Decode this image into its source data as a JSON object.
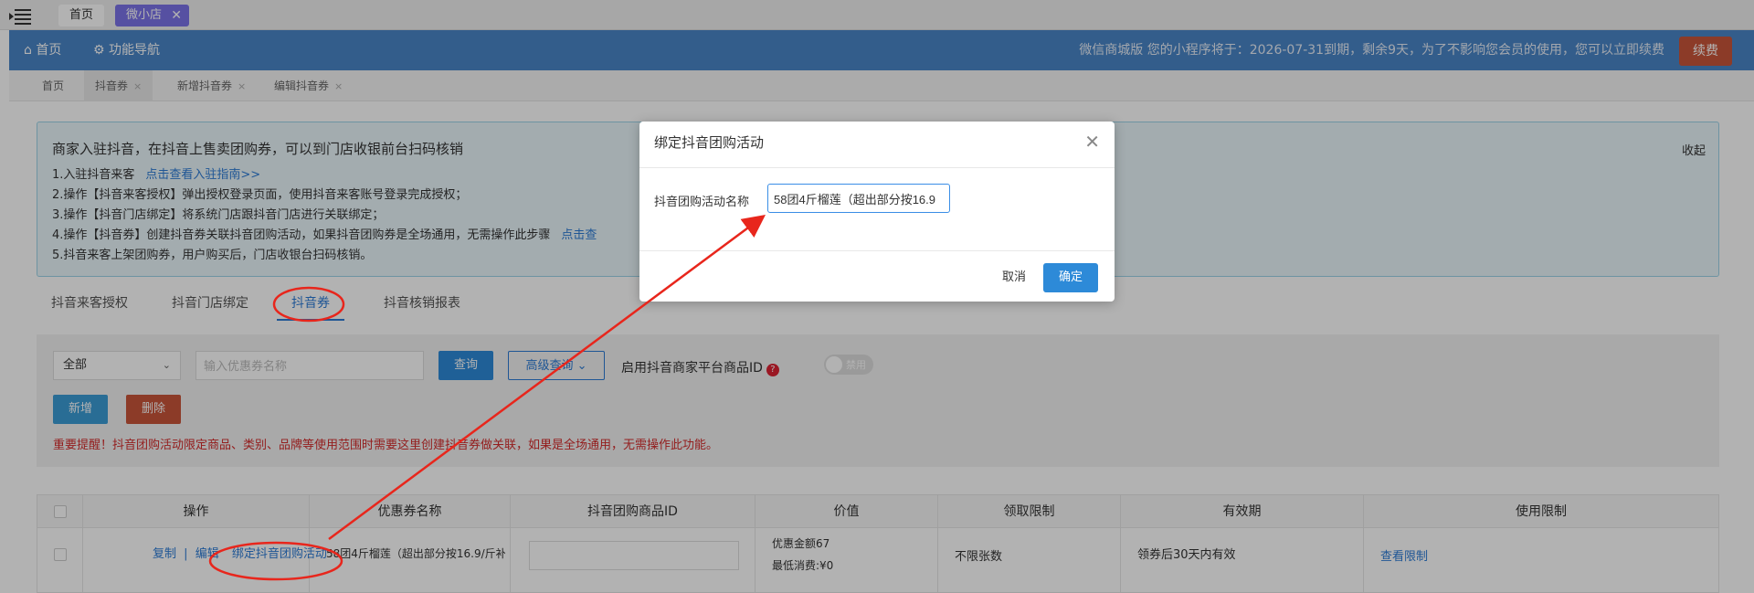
{
  "topbar": {
    "home_tab": "首页",
    "shop_tab": "微小店",
    "close": "✕"
  },
  "header": {
    "home": "⌂ 首页",
    "func_nav": "⚙ 功能导航",
    "notice": "微信商城版   您的小程序将于：2026-07-31到期，剩余9天，为了不影响您会员的使用，您可以立即续费",
    "renew": "续费"
  },
  "breadcrumbs": [
    "首页",
    "抖音券",
    "新增抖音券",
    "编辑抖音券"
  ],
  "guide": {
    "title": "商家入驻抖音，在抖音上售卖团购券，可以到门店收银前台扫码核销",
    "collapse": "收起",
    "line1": "1.入驻抖音来客",
    "line1_link": "点击查看入驻指南>>",
    "line2": "2.操作【抖音来客授权】弹出授权登录页面，使用抖音来客账号登录完成授权；",
    "line3": "3.操作【抖音门店绑定】将系统门店跟抖音门店进行关联绑定；",
    "line4": "4.操作【抖音券】创建抖音券关联抖音团购活动，如果抖音团购券是全场通用，无需操作此步骤",
    "line4_link": "点击查",
    "line5": "5.抖音来客上架团购券，用户购买后，门店收银台扫码核销。"
  },
  "tabs": [
    "抖音来客授权",
    "抖音门店绑定",
    "抖音券",
    "抖音核销报表"
  ],
  "filter": {
    "select_value": "全部",
    "search_placeholder": "输入优惠券名称",
    "query": "查询",
    "advanced": "高级查询 ⌄",
    "enable_label": "启用抖音商家平台商品ID",
    "qmark": "?",
    "toggle_label": "禁用",
    "add": "新增",
    "delete": "删除",
    "warning": "重要提醒！抖音团购活动限定商品、类别、品牌等使用范围时需要这里创建抖音券做关联，如果是全场通用，无需操作此功能。"
  },
  "table": {
    "headers": [
      "操作",
      "优惠券名称",
      "抖音团购商品ID",
      "价值",
      "领取限制",
      "有效期",
      "使用限制"
    ],
    "row": {
      "copy": "复制",
      "sep": "|",
      "edit": "编辑",
      "bind": "绑定抖音团购活动",
      "name": "58团4斤榴莲（超出部分按16.9/斤补",
      "value1": "优惠金额67",
      "value2": "最低消费:¥0",
      "limit": "不限张数",
      "validity": "领券后30天内有效",
      "use_limit": "查看限制"
    }
  },
  "modal": {
    "title": "绑定抖音团购活动",
    "close": "✕",
    "label": "抖音团购活动名称",
    "input_value": "58团4斤榴莲（超出部分按16.9",
    "cancel": "取消",
    "ok": "确定"
  },
  "annotation_color": "#e8261c"
}
